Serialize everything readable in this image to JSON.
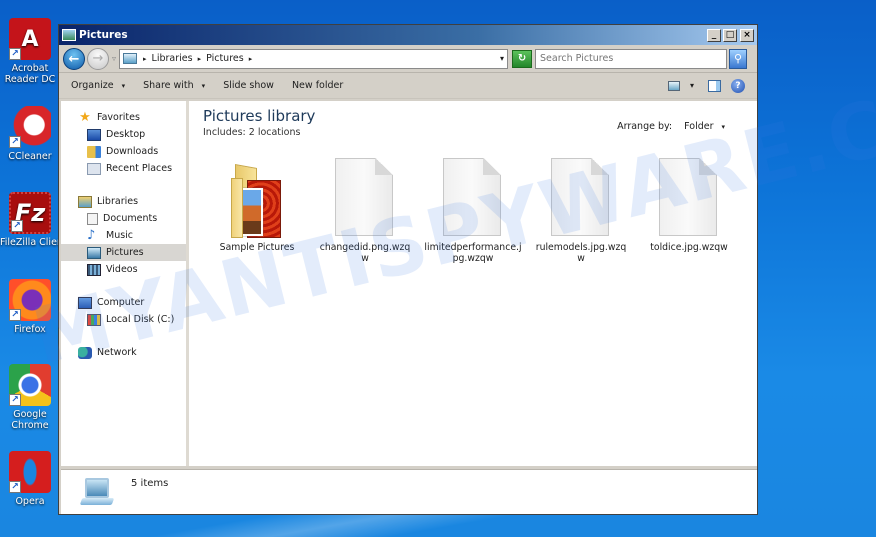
{
  "desktop": {
    "icons": [
      {
        "label_1": "Acrobat",
        "label_2": "Reader DC",
        "glyph": "A"
      },
      {
        "label_1": "CCleaner",
        "label_2": "",
        "glyph": "C"
      },
      {
        "label_1": "FileZilla Client",
        "label_2": "",
        "glyph": "Fz"
      },
      {
        "label_1": "Firefox",
        "label_2": "",
        "glyph": ""
      },
      {
        "label_1": "Google",
        "label_2": "Chrome",
        "glyph": ""
      },
      {
        "label_1": "Opera",
        "label_2": "",
        "glyph": ""
      }
    ],
    "shortcut_glyph": "↗"
  },
  "window": {
    "title": "Pictures",
    "controls": {
      "minimize": "_",
      "maximize": "□",
      "close": "×"
    }
  },
  "addressbar": {
    "back_glyph": "←",
    "forward_glyph": "→",
    "history_caret": "▿",
    "breadcrumb": [
      "Libraries",
      "Pictures"
    ],
    "separator": "▸",
    "crumb_caret": "▾",
    "dropdown_caret": "▾",
    "refresh_glyph": "↻",
    "search_placeholder": "Search Pictures",
    "search_glyph": "⚲"
  },
  "toolbar": {
    "organize": "Organize",
    "share_with": "Share with",
    "slide_show": "Slide show",
    "new_folder": "New folder",
    "caret": "▾",
    "help_glyph": "?"
  },
  "navpane": {
    "favorites": {
      "label": "Favorites",
      "items": [
        "Desktop",
        "Downloads",
        "Recent Places"
      ]
    },
    "libraries": {
      "label": "Libraries",
      "items": [
        "Documents",
        "Music",
        "Pictures",
        "Videos"
      ],
      "selected": "Pictures"
    },
    "computer": {
      "label": "Computer",
      "items": [
        "Local Disk (C:)"
      ]
    },
    "network": {
      "label": "Network"
    }
  },
  "content": {
    "title": "Pictures library",
    "includes": "Includes:  2 locations",
    "arrange_label": "Arrange by:",
    "arrange_value": "Folder",
    "files": [
      {
        "name": "Sample Pictures",
        "type": "folder"
      },
      {
        "name": "changedid.png.wzqw",
        "type": "file"
      },
      {
        "name": "limitedperformance.jpg.wzqw",
        "type": "file"
      },
      {
        "name": "rulemodels.jpg.wzqw",
        "type": "file"
      },
      {
        "name": "toldice.jpg.wzqw",
        "type": "file"
      }
    ]
  },
  "details": {
    "count": "5 items"
  },
  "watermark": "MYANTISPYWARE.COM"
}
